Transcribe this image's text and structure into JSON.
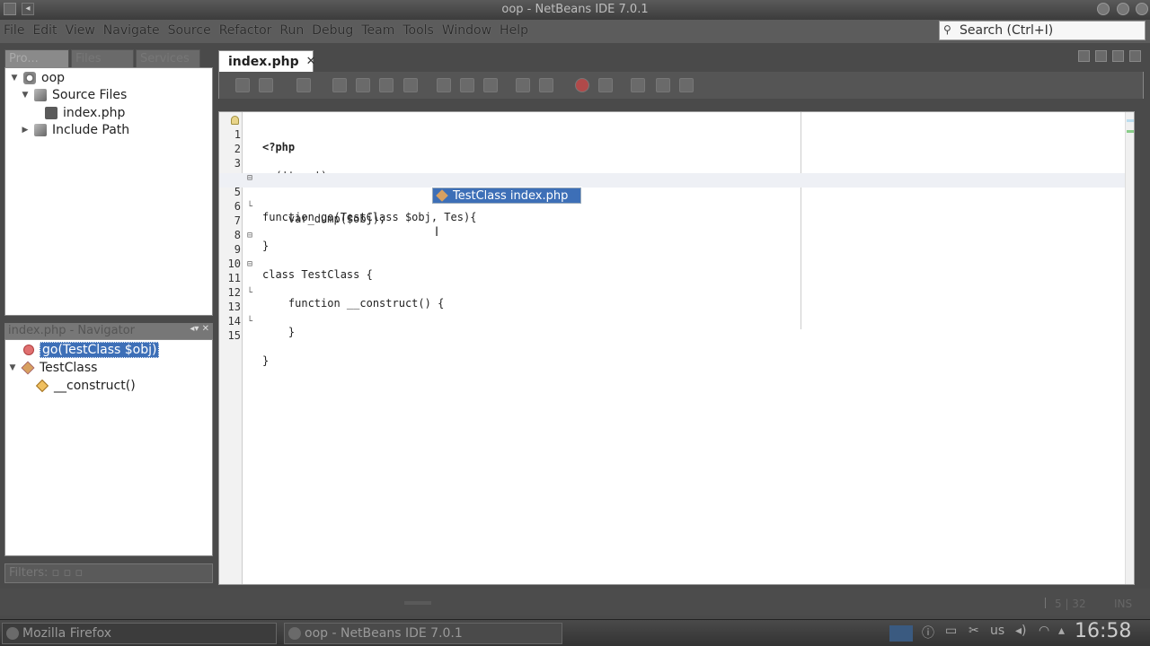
{
  "window": {
    "title": "oop - NetBeans IDE 7.0.1"
  },
  "menu": {
    "items": [
      "File",
      "Edit",
      "View",
      "Navigate",
      "Source",
      "Refactor",
      "Run",
      "Debug",
      "Team",
      "Tools",
      "Window",
      "Help"
    ]
  },
  "search": {
    "placeholder": "Search (Ctrl+I)"
  },
  "projects_panel": {
    "tabs": [
      "Pro...",
      "Files",
      "Services"
    ],
    "tree": [
      {
        "label": "oop",
        "icon": "project-icon"
      },
      {
        "label": "Source Files",
        "icon": "source-folder-icon"
      },
      {
        "label": "index.php",
        "icon": "php-file-icon"
      },
      {
        "label": "Include Path",
        "icon": "include-path-icon"
      }
    ]
  },
  "navigator": {
    "title": "index.php - Navigator",
    "items": [
      {
        "label": "go(TestClass $obj)",
        "icon": "function-icon",
        "selected": true
      },
      {
        "label": "TestClass",
        "icon": "class-icon"
      },
      {
        "label": "__construct()",
        "icon": "method-icon"
      }
    ],
    "filters_label": "Filters:"
  },
  "editor": {
    "tab": {
      "label": "index.php",
      "close": "✕"
    },
    "lines": [
      {
        "num": "1",
        "text": "<?php"
      },
      {
        "num": "2",
        "text": ""
      },
      {
        "num": "3",
        "text": "go('true');"
      },
      {
        "num": "4",
        "text": ""
      },
      {
        "num": "5",
        "text": "function go(TestClass $obj, Tes){"
      },
      {
        "num": "6",
        "text": "    var_dump($obj);"
      },
      {
        "num": "7",
        "text": "}"
      },
      {
        "num": "8",
        "text": ""
      },
      {
        "num": "9",
        "text": "class TestClass {"
      },
      {
        "num": "10",
        "text": ""
      },
      {
        "num": "11",
        "text": "    function __construct() {"
      },
      {
        "num": "12",
        "text": ""
      },
      {
        "num": "13",
        "text": "    }"
      },
      {
        "num": "14",
        "text": ""
      },
      {
        "num": "15",
        "text": "}"
      }
    ],
    "completion": "TestClass index.php"
  },
  "statusbar": {
    "position": "5 | 32",
    "mode": "INS"
  },
  "taskbar": {
    "tasks": [
      "Mozilla Firefox",
      "oop - NetBeans IDE 7.0.1"
    ],
    "keyboard": "us",
    "clock": "16:58"
  },
  "colors": {
    "selection": "#3d6fb7",
    "background": "#4a4a4a",
    "editor": "#ffffff"
  }
}
